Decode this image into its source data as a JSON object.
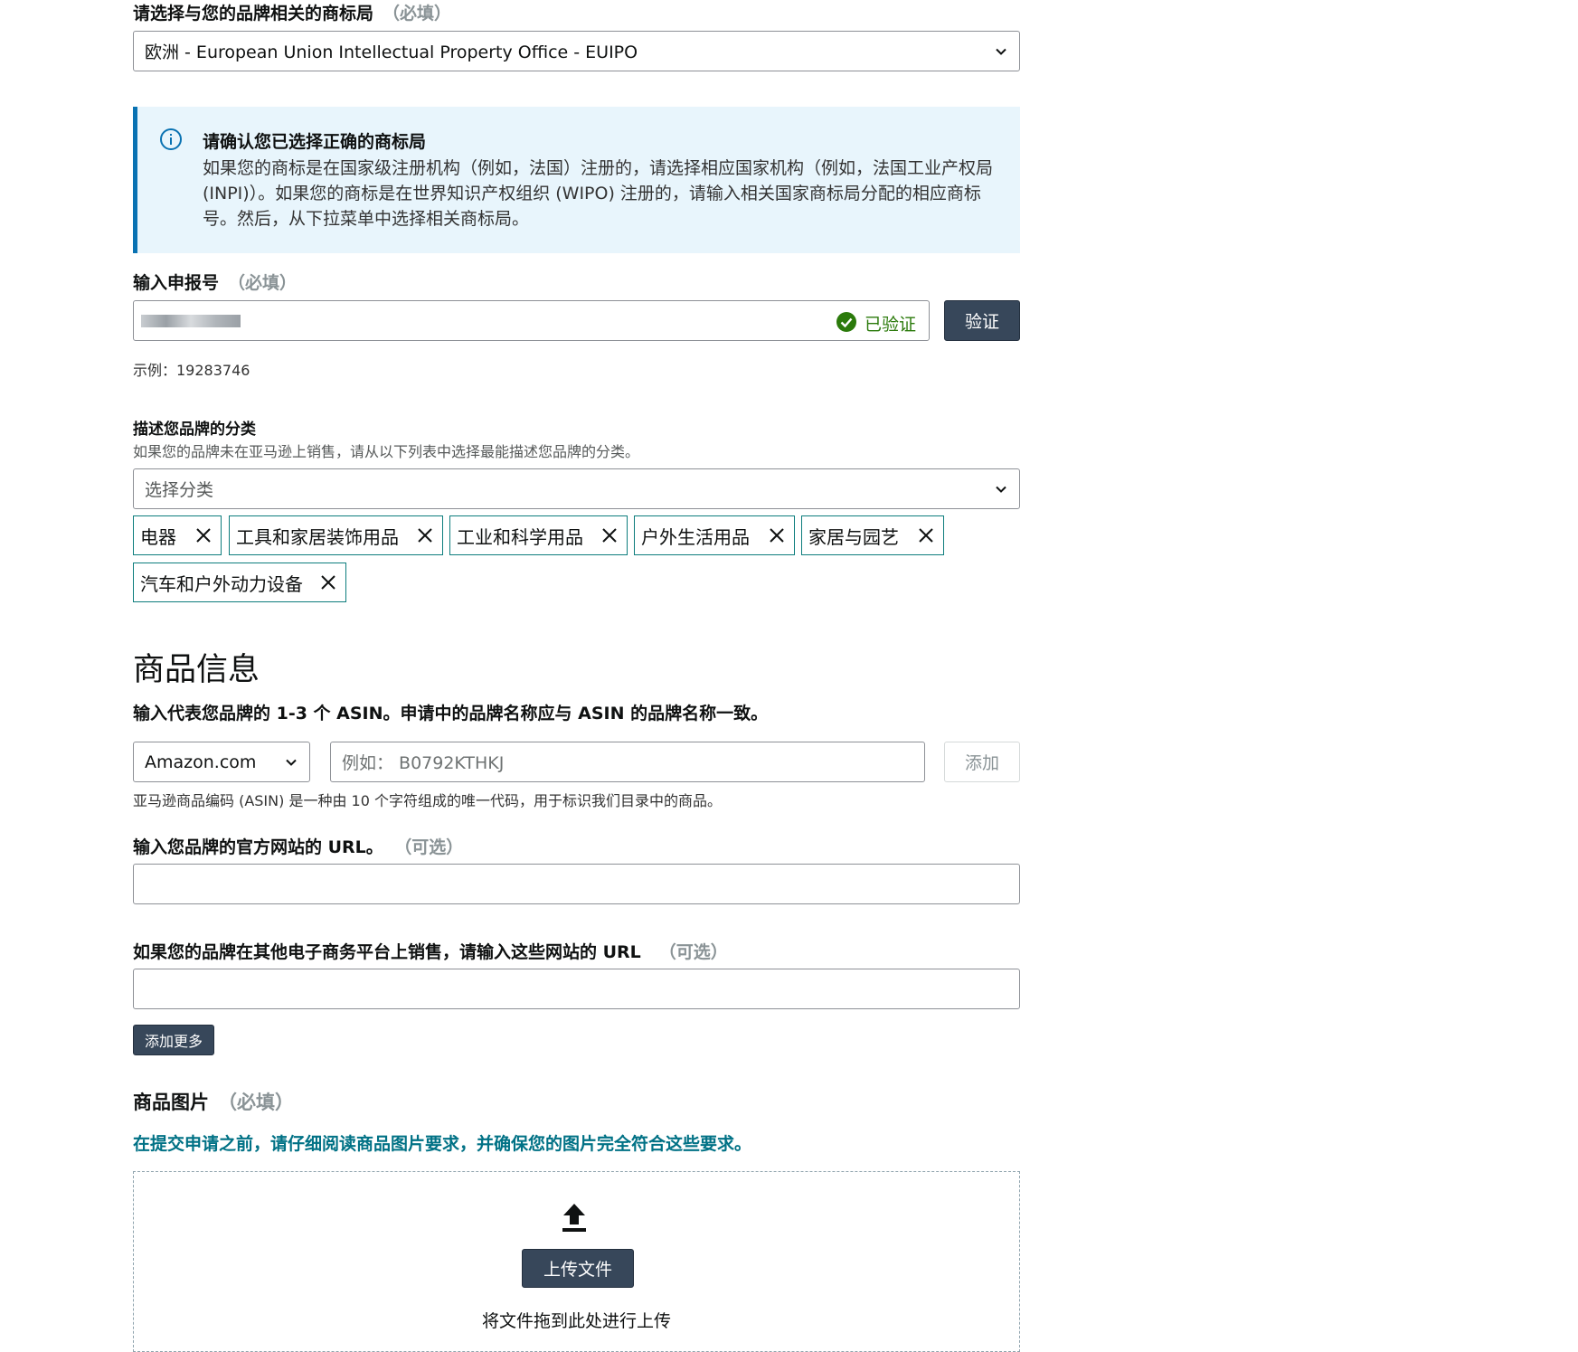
{
  "trademark_office": {
    "label": "请选择与您的品牌相关的商标局",
    "required": "（必填）",
    "selected": "欧洲 - European Union Intellectual Property Office - EUIPO"
  },
  "info_box": {
    "title": "请确认您已选择正确的商标局",
    "body": "如果您的商标是在国家级注册机构（例如，法国）注册的，请选择相应国家机构（例如，法国工业产权局 (INPI)）。如果您的商标是在世界知识产权组织 (WIPO) 注册的，请输入相关国家商标局分配的相应商标号。然后，从下拉菜单中选择相关商标局。",
    "icon": "info-icon",
    "accent_color": "#0972b2",
    "bg_color": "#e8f5fc"
  },
  "application_number": {
    "label": "输入申报号",
    "required": "（必填）",
    "verified_text": "已验证",
    "verify_button": "验证",
    "example": "示例：19283746",
    "verified_color": "#2b7a0b"
  },
  "category": {
    "label": "描述您品牌的分类",
    "helper": "如果您的品牌未在亚马逊上销售，请从以下列表中选择最能描述您品牌的分类。",
    "placeholder": "选择分类",
    "tags": [
      "电器",
      "工具和家居装饰用品",
      "工业和科学用品",
      "户外生活用品",
      "家居与园艺",
      "汽车和户外动力设备"
    ]
  },
  "product_info": {
    "heading": "商品信息",
    "asin_label": "输入代表您品牌的 1-3 个 ASIN。申请中的品牌名称应与 ASIN 的品牌名称一致。",
    "marketplace": "Amazon.com",
    "asin_placeholder": "例如： B0792KTHKJ",
    "add_button": "添加",
    "asin_helper": "亚马逊商品编码 (ASIN) 是一种由 10 个字符组成的唯一代码，用于标识我们目录中的商品。"
  },
  "website": {
    "label": "输入您品牌的官方网站的 URL。",
    "optional": "（可选）"
  },
  "ecommerce": {
    "label": "如果您的品牌在其他电子商务平台上销售，请输入这些网站的 URL",
    "optional": "（可选）",
    "add_more": "添加更多"
  },
  "images": {
    "label": "商品图片",
    "required": "（必填）",
    "notice": "在提交申请之前，请仔细阅读商品图片要求，并确保您的图片完全符合这些要求。",
    "upload_button": "上传文件",
    "drop_text": "将文件拖到此处进行上传",
    "icon": "upload-icon"
  }
}
